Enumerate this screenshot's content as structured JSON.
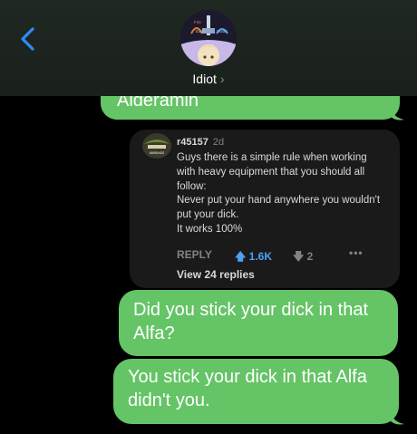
{
  "header": {
    "contact_name": "Idiot",
    "chevron": "›",
    "avatar_badge": {
      "fire": "Fire",
      "earth": "Earth",
      "water": "Water"
    }
  },
  "messages": [
    {
      "text": "Alderamin"
    },
    {
      "text": "Did you stick your dick in that Alfa?"
    },
    {
      "text": "You stick your dick in that Alfa didn't you."
    }
  ],
  "comment": {
    "username": "r45157",
    "age": "2d",
    "avatar_text": "WARUNGS",
    "lines": [
      "Guys there is a simple rule when working",
      "with heavy equipment that  you should all",
      "follow:",
      "Never put your hand anywhere you wouldn't",
      "put your dick.",
      "It works 100%"
    ],
    "reply_label": "REPLY",
    "upvotes": "1.6K",
    "downvotes": "2",
    "more": "•••",
    "view_replies": "View 24 replies"
  },
  "colors": {
    "bubble": "#65c466",
    "card": "#1a1a1b",
    "upvote": "#4f9ff5",
    "back": "#2f8bf6"
  }
}
